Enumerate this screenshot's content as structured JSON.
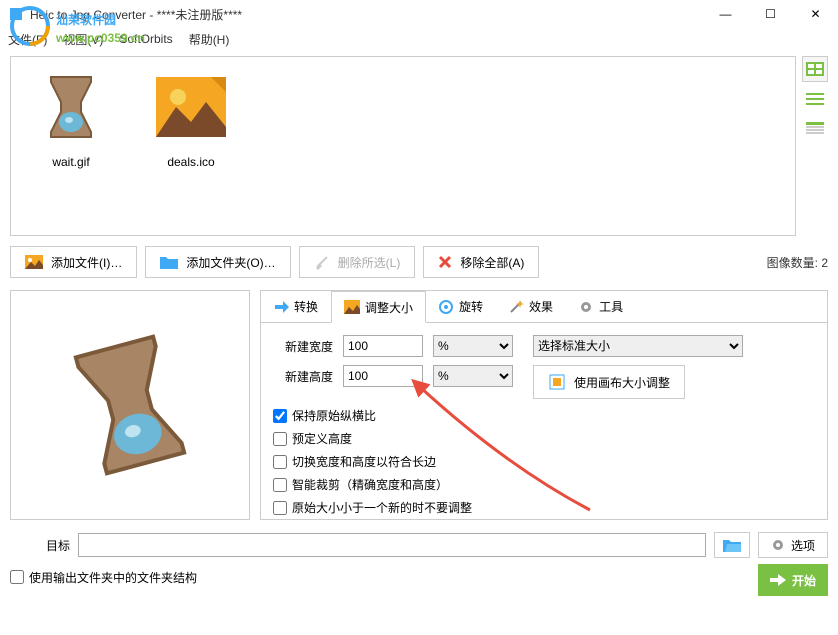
{
  "title": "Heic to Jpg Converter - ****未注册版****",
  "watermark": {
    "text": "汕茉软件园",
    "url": "www.pc0359.cn"
  },
  "menu": {
    "file": "文件(F)",
    "view": "视图(V)",
    "softorbits": "SoftOrbits",
    "help": "帮助(H)"
  },
  "win": {
    "min": "—",
    "max": "☐",
    "close": "✕"
  },
  "gallery": [
    {
      "name": "wait.gif"
    },
    {
      "name": "deals.ico"
    }
  ],
  "actions": {
    "add_file": "添加文件(I)…",
    "add_folder": "添加文件夹(O)…",
    "remove_sel": "删除所选(L)",
    "remove_all": "移除全部(A)",
    "count_label": "图像数量:",
    "count": "2"
  },
  "tabs": {
    "convert": "转换",
    "resize": "调整大小",
    "rotate": "旋转",
    "effect": "效果",
    "tools": "工具"
  },
  "resize": {
    "width_label": "新建宽度",
    "height_label": "新建高度",
    "width_val": "100",
    "height_val": "100",
    "unit": "%",
    "std_label": "选择标准大小",
    "canvas_btn": "使用画布大小调整",
    "keep_ratio": "保持原始纵横比",
    "predef_h": "预定义高度",
    "swap_wh": "切换宽度和高度以符合长边",
    "smart_crop": "智能裁剪（精确宽度和高度）",
    "no_upscale": "原始大小小于一个新的时不要调整"
  },
  "bottom": {
    "dest_label": "目标",
    "options": "选项",
    "use_struct": "使用输出文件夹中的文件夹结构",
    "start": "开始"
  }
}
